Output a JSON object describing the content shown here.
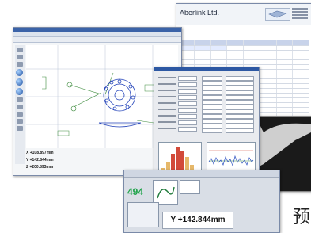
{
  "report": {
    "company": "Aberlink Ltd."
  },
  "cad": {
    "readouts": [
      "X +108.897mm",
      "Y +142.844mm",
      "Z +200.893mm"
    ]
  },
  "measure": {
    "count": "494",
    "y_readout": "Y +142.844mm"
  },
  "side_text": "预"
}
